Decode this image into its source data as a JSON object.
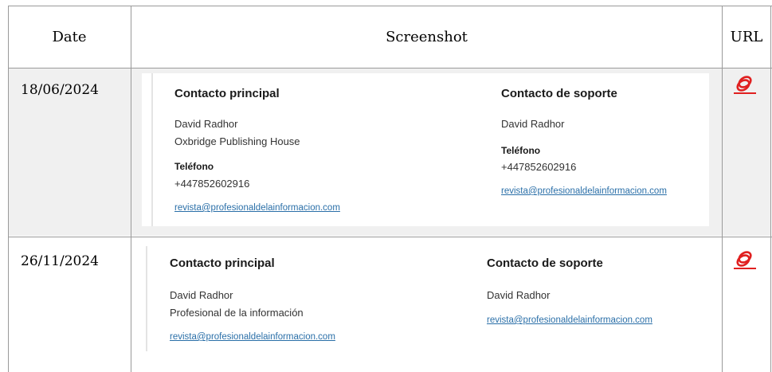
{
  "table": {
    "headers": {
      "date": "Date",
      "screenshot": "Screenshot",
      "url": "URL"
    },
    "rows": [
      {
        "date": "18/06/2024",
        "url_icon": "link-icon",
        "screenshot": {
          "primary": {
            "heading": "Contacto principal",
            "name": "David Radhor",
            "org": "Oxbridge Publishing House",
            "phone_label": "Teléfono",
            "phone": "+447852602916",
            "email": "revista@profesionaldelainformacion.com"
          },
          "support": {
            "heading": "Contacto de soporte",
            "name": "David Radhor",
            "phone_label": "Teléfono",
            "phone": "+447852602916",
            "email": "revista@profesionaldelainformacion.com"
          }
        }
      },
      {
        "date": "26/11/2024",
        "url_icon": "link-icon",
        "screenshot": {
          "primary": {
            "heading": "Contacto principal",
            "name": "David Radhor",
            "org": "Profesional de la información",
            "email": "revista@profesionaldelainformacion.com"
          },
          "support": {
            "heading": "Contacto de soporte",
            "name": "David Radhor",
            "email": "revista@profesionaldelainformacion.com"
          }
        }
      }
    ]
  },
  "colors": {
    "link": "#2a6fa8",
    "icon": "#e02020",
    "row_shade": "#f0f0f0",
    "grid": "#9a9a9a"
  }
}
